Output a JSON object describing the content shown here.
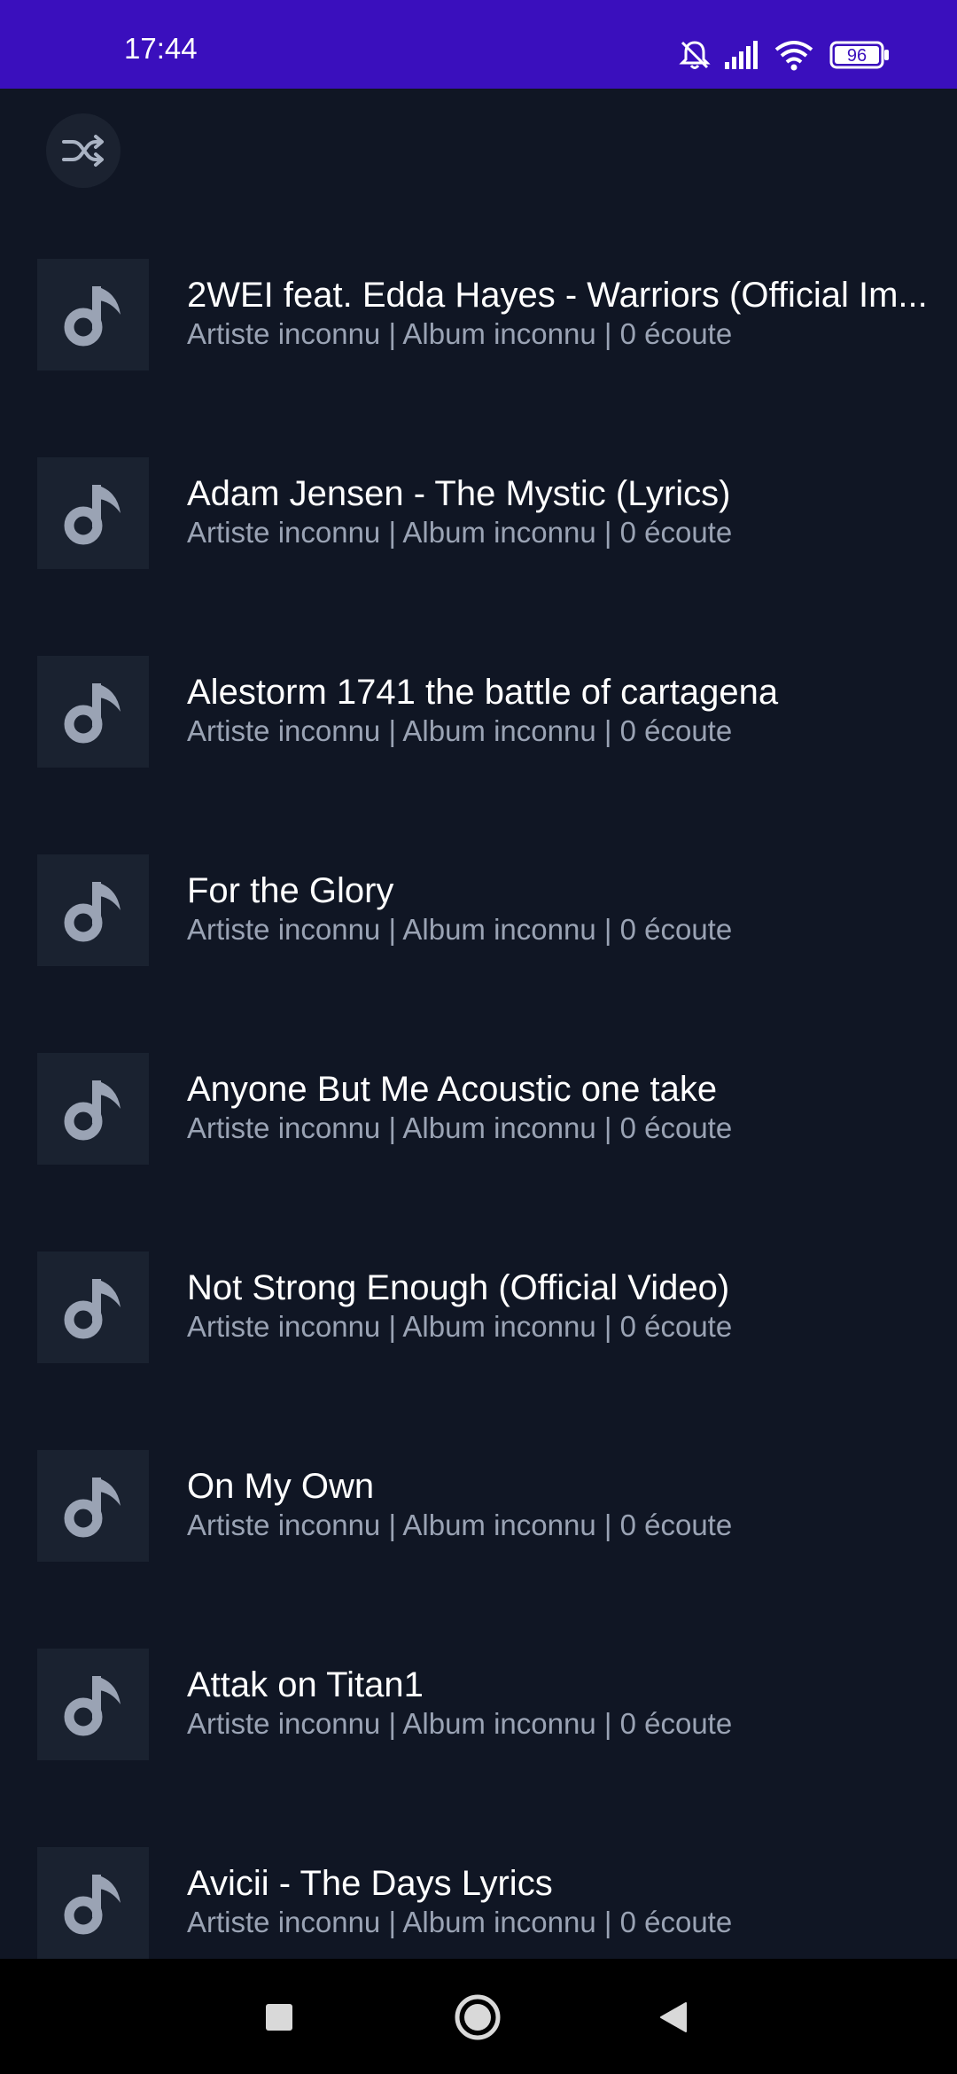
{
  "status_bar": {
    "time": "17:44",
    "battery_level": "96",
    "icons": [
      "mute-icon",
      "signal-icon",
      "wifi-icon",
      "battery-icon"
    ],
    "background_color": "#3a0fbd"
  },
  "toolbar": {
    "shuffle_icon": "shuffle-icon"
  },
  "tracks": [
    {
      "title": "2WEI feat. Edda Hayes - Warriors (Official Im...",
      "subtitle": "Artiste inconnu | Album inconnu | 0 écoute"
    },
    {
      "title": "Adam Jensen - The Mystic (Lyrics)",
      "subtitle": "Artiste inconnu | Album inconnu | 0 écoute"
    },
    {
      "title": "Alestorm  1741 the battle of cartagena",
      "subtitle": "Artiste inconnu | Album inconnu | 0 écoute"
    },
    {
      "title": "For the Glory",
      "subtitle": "Artiste inconnu | Album inconnu | 0 écoute"
    },
    {
      "title": "Anyone But Me Acoustic one take",
      "subtitle": "Artiste inconnu | Album inconnu | 0 écoute"
    },
    {
      "title": "Not Strong Enough (Official Video)",
      "subtitle": "Artiste inconnu | Album inconnu | 0 écoute"
    },
    {
      "title": "On My Own",
      "subtitle": "Artiste inconnu | Album inconnu | 0 écoute"
    },
    {
      "title": "Attak on Titan1",
      "subtitle": "Artiste inconnu | Album inconnu | 0 écoute"
    },
    {
      "title": "Avicii - The Days Lyrics",
      "subtitle": "Artiste inconnu | Album inconnu | 0 écoute"
    }
  ],
  "nav": {
    "icons": [
      "recents-square-icon",
      "home-circle-icon",
      "back-triangle-icon"
    ]
  },
  "colors": {
    "background": "#101624",
    "artwork_bg": "#1a2230",
    "note_icon": "#9aa3b4",
    "subtitle": "#9aa3b4",
    "title": "#ffffff"
  }
}
